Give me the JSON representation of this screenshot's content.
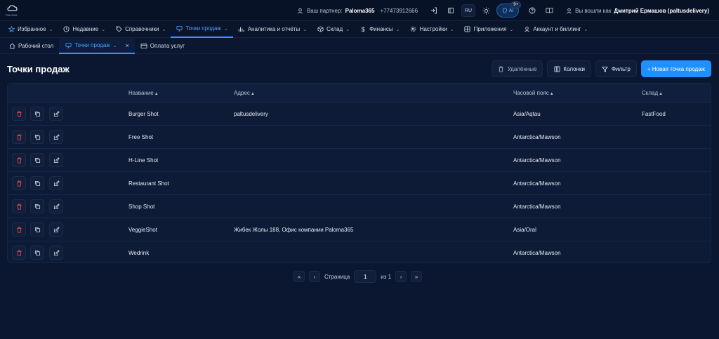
{
  "topbar": {
    "logo_text": "PALOMA",
    "partner_label": "Ваш партнер:",
    "partner_name": "Paloma365",
    "partner_phone": "+77473912666",
    "lang": "RU",
    "ai_label": "AI",
    "ai_badge": "9+",
    "user_label": "Вы вошли как",
    "user_name": "Дмитрий Ермашов (paltusdelivery)"
  },
  "nav": [
    {
      "label": "Избранное",
      "icon": "star-icon"
    },
    {
      "label": "Недавние",
      "icon": "clock-icon"
    },
    {
      "label": "Справочники",
      "icon": "tag-icon"
    },
    {
      "label": "Точки продаж",
      "icon": "monitor-icon",
      "active": true
    },
    {
      "label": "Аналитика и отчёты",
      "icon": "chart-icon"
    },
    {
      "label": "Склад",
      "icon": "box-icon"
    },
    {
      "label": "Финансы",
      "icon": "dollar-icon"
    },
    {
      "label": "Настройки",
      "icon": "gear-icon"
    },
    {
      "label": "Приложения",
      "icon": "grid-icon"
    },
    {
      "label": "Аккаунт и биллинг",
      "icon": "user-icon"
    }
  ],
  "tabs": [
    {
      "label": "Рабочий стол",
      "icon": "home-icon"
    },
    {
      "label": "Точки продаж",
      "icon": "monitor-icon",
      "active": true
    },
    {
      "label": "Оплата услуг",
      "icon": "card-icon"
    }
  ],
  "page": {
    "title": "Точки продаж",
    "deleted_label": "Удалённые",
    "columns_label": "Колонки",
    "filter_label": "Фильтр",
    "new_label": "+ Новая точка продаж"
  },
  "table": {
    "headers": [
      "Название",
      "Адрес",
      "Часовой пояс",
      "Склад"
    ],
    "rows": [
      {
        "name": "Burger Shot",
        "address": "paltusdelivery",
        "tz": "Asia/Aqtau",
        "warehouse": "FastFood"
      },
      {
        "name": "Free Shot",
        "address": "",
        "tz": "Antarctica/Mawson",
        "warehouse": ""
      },
      {
        "name": "H-Line Shot",
        "address": "",
        "tz": "Antarctica/Mawson",
        "warehouse": ""
      },
      {
        "name": "Restaurant Shot",
        "address": "",
        "tz": "Antarctica/Mawson",
        "warehouse": ""
      },
      {
        "name": "Shop Shot",
        "address": "",
        "tz": "Antarctica/Mawson",
        "warehouse": ""
      },
      {
        "name": "VeggieShot",
        "address": "Жибек Жолы 188, Офис компании Paloma365",
        "tz": "Asia/Oral",
        "warehouse": ""
      },
      {
        "name": "Wedrink",
        "address": "",
        "tz": "Antarctica/Mawson",
        "warehouse": ""
      }
    ]
  },
  "pager": {
    "first": "«",
    "prev": "‹",
    "page_label": "Страница",
    "page_value": "1",
    "of_label": "из 1",
    "next": "›",
    "last": "»"
  },
  "colors": {
    "accent": "#1e90ff",
    "delete": "#ff4d5a",
    "background": "#0b1730"
  }
}
